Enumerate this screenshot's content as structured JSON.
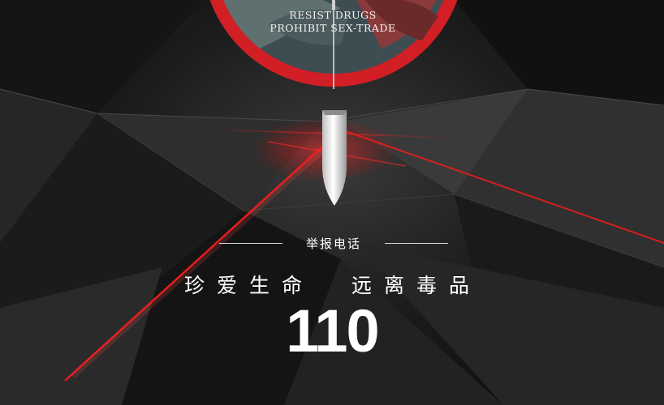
{
  "poster": {
    "tagline_line1": "RESIST DRUGS",
    "tagline_line2": "PROHIBIT SEX-TRADE",
    "hotline_label": "举报电话",
    "slogan": "珍爱生命  远离毒品",
    "hotline_number": "110"
  },
  "colors": {
    "background": "#0e0e0e",
    "ring_red": "#d21f26",
    "laser_red": "#ff1a1a",
    "text": "#ffffff"
  },
  "icons": [
    "no-drugs-ring-icon",
    "syringe-needle-icon",
    "needle-tip-icon"
  ]
}
